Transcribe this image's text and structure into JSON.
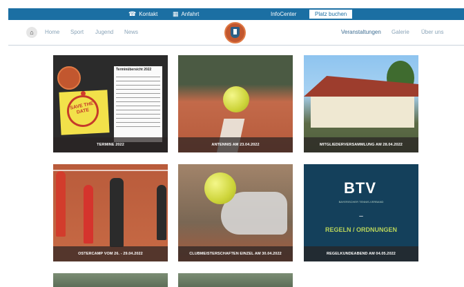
{
  "topbar": {
    "kontakt": "Kontakt",
    "anfahrt": "Anfahrt",
    "infocenter": "InfoCenter",
    "book": "Platz buchen",
    "bg_color": "#1b6fa3"
  },
  "nav": {
    "left": [
      "Home",
      "Sport",
      "Jugend",
      "News"
    ],
    "right": [
      "Veranstaltungen",
      "Galerie",
      "Über uns"
    ]
  },
  "tiles": [
    {
      "caption": "TERMINE 2022",
      "board_title": "Terminübersicht 2022",
      "stamp": "SAVE THE DATE"
    },
    {
      "caption": "ANTENNIS AM 23.04.2022"
    },
    {
      "caption": "MITGLIEDERVERSAMMLUNG AM 28.04.2022"
    },
    {
      "caption": "OSTERCAMP VOM 26. - 29.04.2022"
    },
    {
      "caption": "CLUBMEISTERSCHAFTEN EINZEL AM 30.04.2022"
    },
    {
      "caption": "REGELKUNDEABEND AM 04.05.2022",
      "btv": "BTV",
      "btv_sub": "BAYERISCHER TENNIS-VERBAND",
      "dash": "–",
      "regeln": "REGELN / ORDNUNGEN"
    }
  ]
}
